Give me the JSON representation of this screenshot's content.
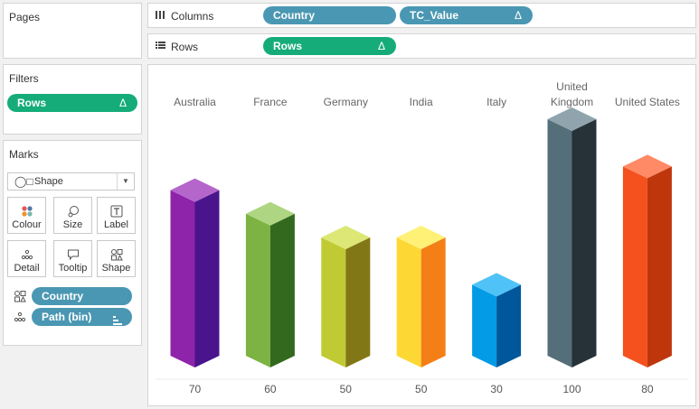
{
  "pages": {
    "title": "Pages"
  },
  "filters": {
    "title": "Filters",
    "pills": [
      {
        "label": "Rows",
        "icon": "delta-icon"
      }
    ]
  },
  "marks": {
    "title": "Marks",
    "type_label": "Shape",
    "buttons": {
      "colour": "Colour",
      "size": "Size",
      "label": "Label",
      "detail": "Detail",
      "tooltip": "Tooltip",
      "shape": "Shape"
    },
    "fields": [
      {
        "label": "Country",
        "encoding": "shape"
      },
      {
        "label": "Path (bin)",
        "encoding": "detail",
        "icon": "bin-icon"
      }
    ]
  },
  "shelves": {
    "columns": {
      "label": "Columns",
      "pills": [
        "Country",
        "TC_Value"
      ]
    },
    "rows": {
      "label": "Rows",
      "pills": [
        "Rows"
      ]
    }
  },
  "chart_data": {
    "type": "bar",
    "categories": [
      {
        "lines": [
          "Australia"
        ]
      },
      {
        "lines": [
          "France"
        ]
      },
      {
        "lines": [
          "Germany"
        ]
      },
      {
        "lines": [
          "India"
        ]
      },
      {
        "lines": [
          "Italy"
        ]
      },
      {
        "lines": [
          "United",
          "Kingdom"
        ]
      },
      {
        "lines": [
          "United States"
        ]
      }
    ],
    "values": [
      70,
      60,
      50,
      50,
      30,
      100,
      80
    ],
    "value_labels": [
      "70",
      "60",
      "50",
      "50",
      "30",
      "100",
      "80"
    ],
    "colors": [
      {
        "top": "#b466cb",
        "front": "#8e24aa",
        "side": "#4a148c"
      },
      {
        "top": "#aed581",
        "front": "#7cb342",
        "side": "#33691e"
      },
      {
        "top": "#dce775",
        "front": "#c0ca33",
        "side": "#827717"
      },
      {
        "top": "#fff176",
        "front": "#fdd835",
        "side": "#f57f17"
      },
      {
        "top": "#4fc3f7",
        "front": "#039be5",
        "side": "#01579b"
      },
      {
        "top": "#90a4ae",
        "front": "#546e7a",
        "side": "#263238"
      },
      {
        "top": "#ff8a65",
        "front": "#f4511e",
        "side": "#bf360c"
      }
    ],
    "ylim": [
      0,
      100
    ],
    "style": "3d-column"
  }
}
